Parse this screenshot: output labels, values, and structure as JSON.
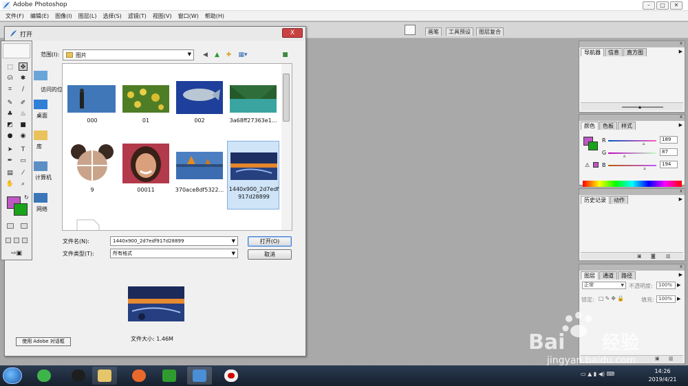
{
  "app": {
    "title": "Adobe Photoshop",
    "window_buttons": [
      "–",
      "□",
      "✕"
    ]
  },
  "menubar": {
    "items": [
      "文件(F)",
      "编辑(E)",
      "图像(I)",
      "图层(L)",
      "选择(S)",
      "滤镜(T)",
      "视图(V)",
      "窗口(W)",
      "帮助(H)"
    ]
  },
  "optionsbar": {
    "palette_tabs": [
      "画笔",
      "工具预设",
      "图层复合"
    ]
  },
  "dialog": {
    "title": "打开",
    "close_label": "X",
    "look_in_label": "范围(I):",
    "location": "图片",
    "places": [
      "访问的位置",
      "桌面",
      "库",
      "计算机",
      "网络"
    ],
    "files": [
      {
        "name": "000"
      },
      {
        "name": "01"
      },
      {
        "name": "002"
      },
      {
        "name": "3a68ff27363e1..."
      },
      {
        "name": "9"
      },
      {
        "name": "00011"
      },
      {
        "name": "370ace8df5322..."
      },
      {
        "name": "1440x900_2d7edf917d28899",
        "line1": "1440x900_2d7edf",
        "line2": "917d28899",
        "selected": true
      }
    ],
    "filename_label": "文件名(N):",
    "filename_value": "1440x900_2d7edf917d28899",
    "filetype_label": "文件类型(T):",
    "filetype_value": "所有格式",
    "open_button": "打开(O)",
    "cancel_button": "取消",
    "file_size": "文件大小: 1.46M",
    "adobe_dialog_button": "使用 Adobe 对话框"
  },
  "panels": {
    "navigator": {
      "tabs": [
        "导航器",
        "信息",
        "直方图"
      ]
    },
    "color": {
      "tabs": [
        "颜色",
        "色板",
        "样式"
      ],
      "r_label": "R",
      "g_label": "G",
      "b_label": "B",
      "r": 189,
      "g": 87,
      "b": 194,
      "foreground": "#bd57c2",
      "background": "#19a319"
    },
    "history": {
      "tabs": [
        "历史记录",
        "动作"
      ]
    },
    "layers": {
      "tabs": [
        "图层",
        "通道",
        "路径"
      ],
      "blend_mode": "正常",
      "opacity_label": "不透明度:",
      "opacity": "100%",
      "lock_label": "锁定:",
      "fill_label": "填充:",
      "fill": "100%"
    }
  },
  "taskbar": {
    "time": "14:26",
    "date": "2019/4/21"
  },
  "watermark": {
    "brand_latin": "Bai",
    "brand_cn": "经验",
    "url": "jingyan.baidu.com"
  },
  "colors": {
    "accent_selection": "#cfe4f7",
    "dialog_close": "#c94242"
  }
}
